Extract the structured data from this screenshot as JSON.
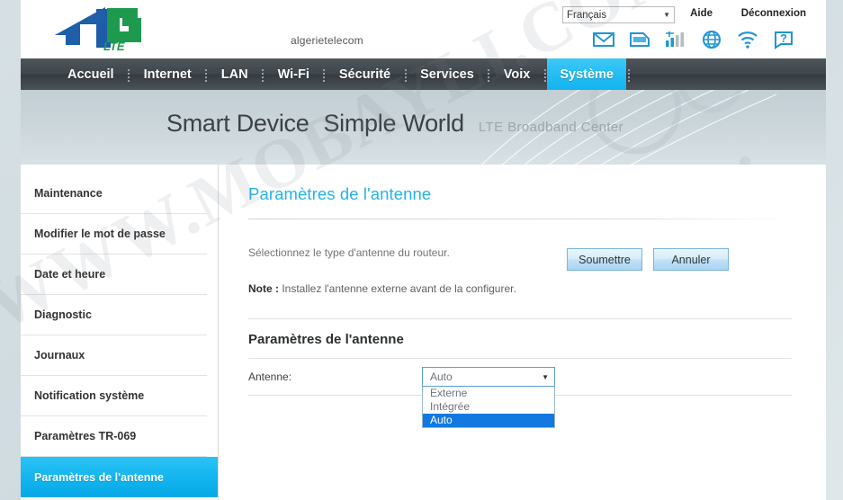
{
  "header": {
    "logo_4": "4",
    "logo_g": "G",
    "logo_lte": "LTE",
    "brand": "algerietelecom",
    "language": {
      "value": "Français",
      "caret": "▼"
    },
    "help_label": "Aide",
    "logout_label": "Déconnexion",
    "icons": [
      {
        "name": "sms-envelope-icon",
        "title": "SMS"
      },
      {
        "name": "usim-card-icon",
        "title": "USIM"
      },
      {
        "name": "signal-bars-icon",
        "title": "Signal"
      },
      {
        "name": "globe-internet-icon",
        "title": "Internet"
      },
      {
        "name": "wifi-icon",
        "title": "Wi-Fi"
      },
      {
        "name": "help-question-icon",
        "title": "Aide"
      }
    ]
  },
  "nav": {
    "items": [
      {
        "label": "Accueil",
        "active": false
      },
      {
        "label": "Internet",
        "active": false
      },
      {
        "label": "LAN",
        "active": false
      },
      {
        "label": "Wi-Fi",
        "active": false
      },
      {
        "label": "Sécurité",
        "active": false
      },
      {
        "label": "Services",
        "active": false
      },
      {
        "label": "Voix",
        "active": false
      },
      {
        "label": "Système",
        "active": true
      }
    ]
  },
  "banner": {
    "slogan_1": "Smart Device",
    "slogan_2": "Simple World",
    "subtitle": "LTE Broadband Center"
  },
  "sidebar": {
    "items": [
      {
        "label": "Maintenance",
        "active": false
      },
      {
        "label": "Modifier le mot de passe",
        "active": false
      },
      {
        "label": "Date et heure",
        "active": false
      },
      {
        "label": "Diagnostic",
        "active": false
      },
      {
        "label": "Journaux",
        "active": false
      },
      {
        "label": "Notification système",
        "active": false
      },
      {
        "label": "Paramètres TR-069",
        "active": false
      },
      {
        "label": "Paramètres de l'antenne",
        "active": true
      }
    ]
  },
  "main": {
    "page_title": "Paramètres de l'antenne",
    "intro": "Sélectionnez le type d'antenne du routeur.",
    "note_label": "Note :",
    "note_text": " Installez l'antenne externe avant de la configurer.",
    "section_title": "Paramètres de l'antenne",
    "antenna_label": "Antenne:",
    "antenna_value": "Auto",
    "antenna_caret": "▼",
    "antenna_options": [
      {
        "label": "Externe",
        "selected": false
      },
      {
        "label": "Intégrée",
        "selected": false
      },
      {
        "label": "Auto",
        "selected": true
      }
    ],
    "submit_label": "Soumettre",
    "cancel_label": "Annuler"
  },
  "watermark": {
    "text": "WWW.MOBAYLI.COM"
  },
  "colors": {
    "accent_cyan": "#12b4ef",
    "title_cyan": "#23b3e8",
    "option_highlight": "#1379e0",
    "nav_dark": "#3f474d"
  }
}
